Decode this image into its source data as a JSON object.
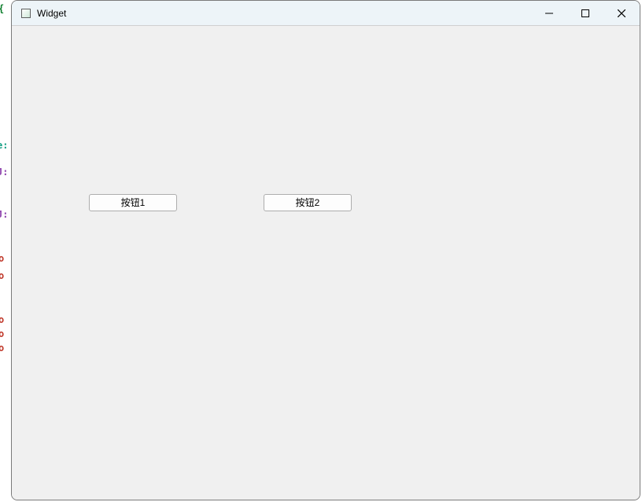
{
  "window": {
    "title": "Widget"
  },
  "buttons": {
    "btn1_label": "按钮1",
    "btn2_label": "按钮2"
  },
  "bg_fragments": {
    "f1": "{",
    "f2": "e:",
    "f3": "J:",
    "f4": "J:",
    "f5": "o",
    "f6": "o",
    "f7": "o",
    "f8": "o",
    "f9": "o"
  }
}
